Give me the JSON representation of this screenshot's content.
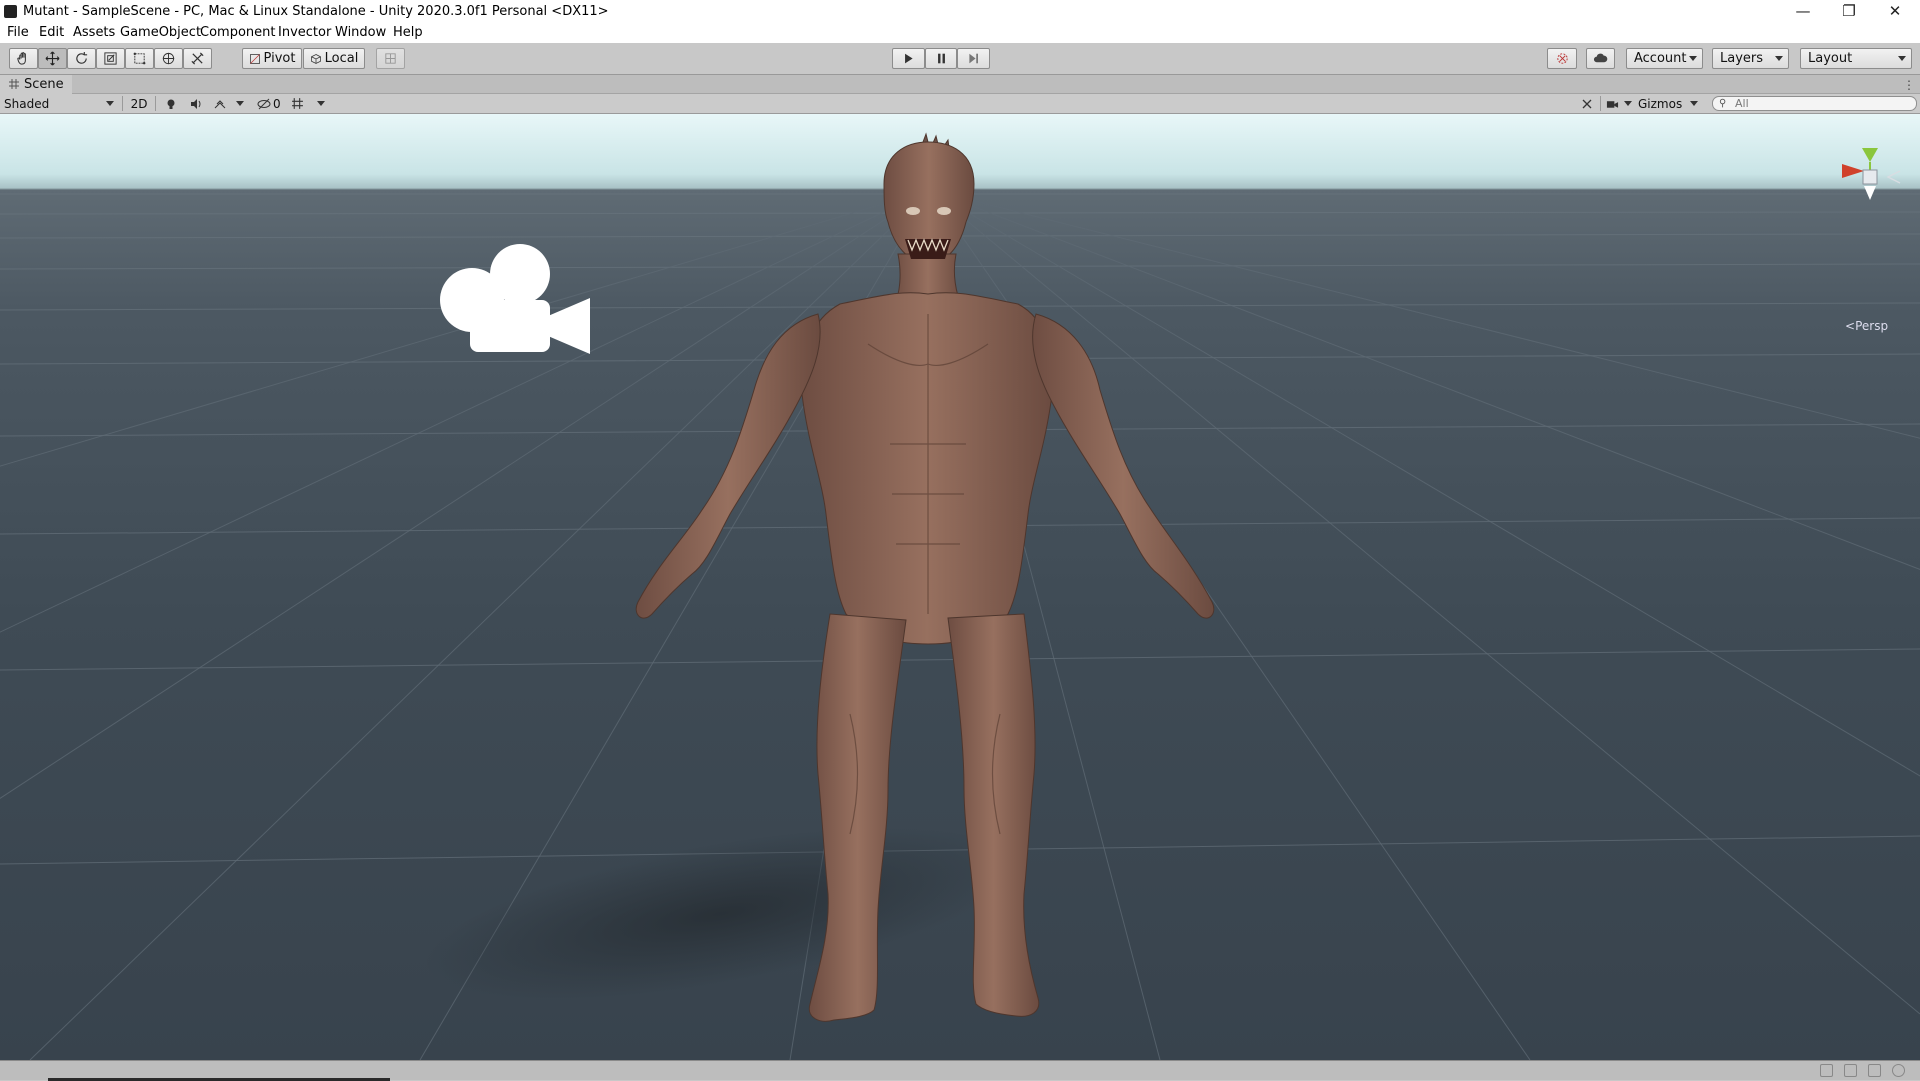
{
  "window": {
    "title": "Mutant - SampleScene - PC, Mac & Linux Standalone - Unity 2020.3.0f1 Personal <DX11>",
    "minimize": "—",
    "restore": "❐",
    "close": "✕"
  },
  "menu": [
    "File",
    "Edit",
    "Assets",
    "GameObject",
    "Component",
    "Invector",
    "Window",
    "Help"
  ],
  "toolbar": {
    "pivot_label": "Pivot",
    "local_label": "Local",
    "account_label": "Account",
    "layers_label": "Layers",
    "layout_label": "Layout"
  },
  "scene": {
    "tab_label": "Scene",
    "shading_mode": "Shaded",
    "mode_2d": "2D",
    "hidden_count": "0",
    "gizmos_label": "Gizmos",
    "search_placeholder": "All",
    "projection_label": "Persp"
  },
  "colors": {
    "gizmo_x": "#d0412b",
    "gizmo_y": "#8ac63c",
    "gizmo_z": "#3a77d0",
    "skin": "#8a6453"
  }
}
